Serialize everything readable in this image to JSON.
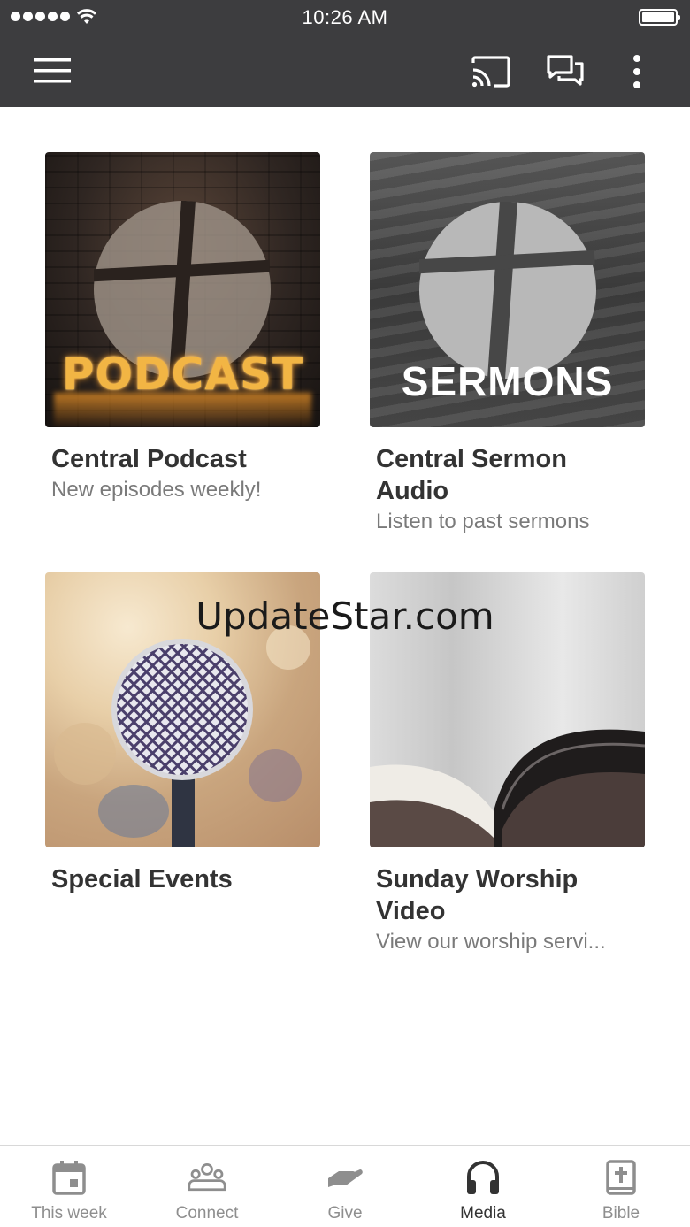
{
  "status_bar": {
    "time": "10:26 AM"
  },
  "app_bar": {
    "icons": [
      "menu-icon",
      "cast-icon",
      "chat-icon",
      "more-vert-icon"
    ]
  },
  "media_items": [
    {
      "title": "Central Podcast",
      "subtitle": "New episodes weekly!",
      "artwork_text": "PODCAST"
    },
    {
      "title": "Central Sermon Audio",
      "subtitle": "Listen to past sermons",
      "artwork_text": "SERMONS"
    },
    {
      "title": "Special Events",
      "subtitle": ""
    },
    {
      "title": "Sunday Worship Video",
      "subtitle": "View our worship servi..."
    }
  ],
  "watermark": "UpdateStar.com",
  "tab_bar": {
    "active": "Media",
    "tabs": [
      {
        "label": "This week",
        "icon": "calendar-icon"
      },
      {
        "label": "Connect",
        "icon": "people-icon"
      },
      {
        "label": "Give",
        "icon": "give-hand-icon"
      },
      {
        "label": "Media",
        "icon": "headphones-icon"
      },
      {
        "label": "Bible",
        "icon": "bible-icon"
      }
    ]
  },
  "colors": {
    "app_bar": "#3d3d3f",
    "title_text": "#333333",
    "subtitle_text": "#7a7a7a",
    "inactive_tab": "#8e8e8e"
  }
}
